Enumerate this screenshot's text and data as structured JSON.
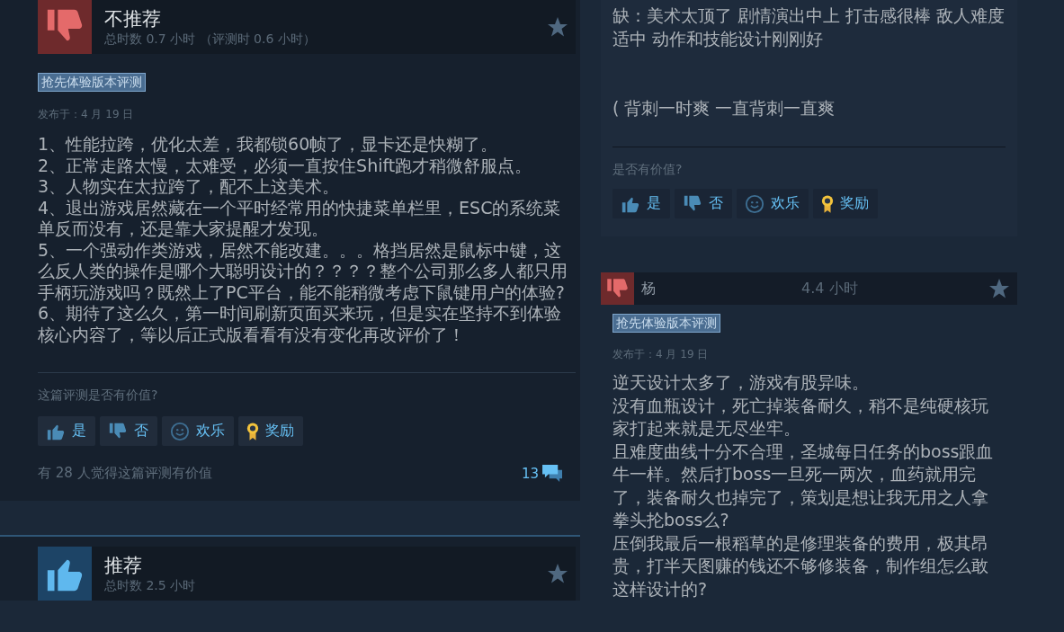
{
  "left_column": {
    "reviews": [
      {
        "kind": "full",
        "verdict": "不推荐",
        "recommended": false,
        "playtime": "总时数 0.7 小时 （评测时 0.6 小时）",
        "tag": "抢先体验版本评测",
        "posted": "发布于：4 月 19 日",
        "body": [
          "1、性能拉跨，优化太差，我都锁60帧了，显卡还是快糊了。",
          "2、正常走路太慢，太难受，必须一直按住Shift跑才稍微舒服点。",
          "3、人物实在太拉跨了，配不上这美术。",
          "4、退出游戏居然藏在一个平时经常用的快捷菜单栏里，ESC的系统菜单反而没有，还是靠大家提醒才发现。",
          "5、一个强动作类游戏，居然不能改建。。。格挡居然是鼠标中键，这么反人类的操作是哪个大聪明设计的？？？？整个公司那么多人都只用手柄玩游戏吗？既然上了PC平台，能不能稍微考虑下鼠键用户的体验?",
          "6、期待了这么久，第一时间刷新页面买来玩，但是实在坚持不到体验核心内容了，等以后正式版看看有没有变化再改评价了！"
        ],
        "helpful_prompt": "这篇评测是否有价值?",
        "votes": [
          {
            "kind": "yes",
            "label": "是"
          },
          {
            "kind": "no",
            "label": "否"
          },
          {
            "kind": "funny",
            "label": "欢乐"
          },
          {
            "kind": "award",
            "label": "奖励"
          }
        ],
        "helpful_count": "有 28 人觉得这篇评测有价值",
        "comments": "13"
      },
      {
        "kind": "full",
        "verdict": "推荐",
        "recommended": true,
        "playtime": "总时数 2.5 小时"
      }
    ]
  },
  "right_column": {
    "reviews": [
      {
        "kind": "continuation",
        "body": [
          "缺：美术太顶了 剧情演出中上 打击感很棒 敌人难度适中 动作和技能设计刚刚好",
          "( 背刺一时爽 一直背刺一直爽"
        ],
        "helpful_prompt": "是否有价值?",
        "votes": [
          {
            "kind": "yes",
            "label": "是"
          },
          {
            "kind": "no",
            "label": "否"
          },
          {
            "kind": "funny",
            "label": "欢乐"
          },
          {
            "kind": "award",
            "label": "奖励"
          }
        ]
      },
      {
        "kind": "compact",
        "author": "杨",
        "recommended": false,
        "playtime": "4.4 小时",
        "tag": "抢先体验版本评测",
        "posted": "发布于：4 月 19 日",
        "body": [
          "逆天设计太多了，游戏有股异味。",
          "没有血瓶设计，死亡掉装备耐久，稍不是纯硬核玩家打起来就是无尽坐牢。",
          "且难度曲线十分不合理，圣城每日任务的boss跟血牛一样。然后打boss一旦死一两次，血药就用完了，装备耐久也掉完了，策划是想让我无用之人拿拳头抡boss么?",
          "压倒我最后一根稻草的是修理装备的费用，极其昂贵，打半天图赚的钱还不够修装备，制作组怎么敢这样设计的?"
        ]
      }
    ]
  }
}
